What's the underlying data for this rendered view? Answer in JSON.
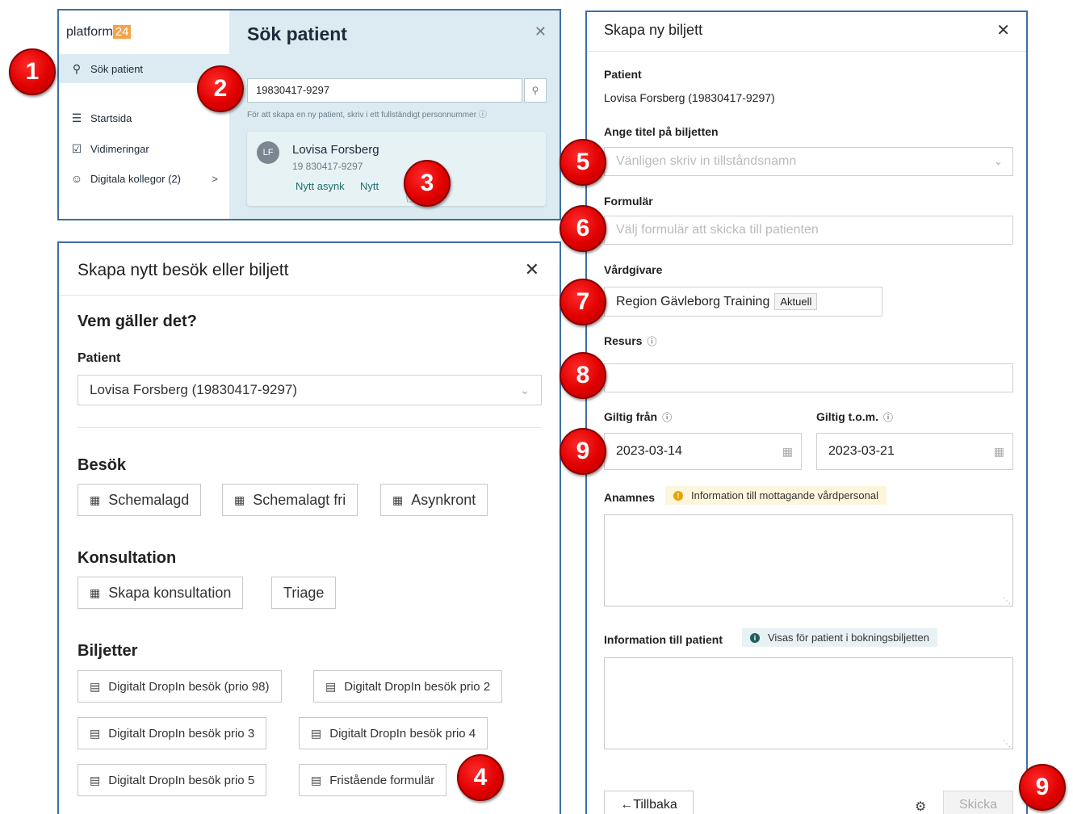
{
  "search_panel": {
    "logo_text": "platform",
    "logo_number": "24",
    "nav": [
      {
        "label": "Sök patient",
        "icon": "search-icon"
      },
      {
        "label": "Startsida",
        "icon": "list-icon"
      },
      {
        "label": "Vidimeringar",
        "icon": "checkbox-icon"
      },
      {
        "label": "Digitala kollegor (2)",
        "icon": "people-icon"
      }
    ],
    "title": "Sök patient",
    "search_value": "19830417-9297",
    "hint": "För att skapa en ny patient, skriv i ett fullständigt personnummer",
    "result": {
      "initials": "LF",
      "name": "Lovisa Forsberg",
      "id": "19 830417-9297",
      "link_async": "Nytt asynk",
      "link_new": "Nytt"
    }
  },
  "visit_panel": {
    "title": "Skapa nytt besök eller biljett",
    "question": "Vem gäller det?",
    "patient_label": "Patient",
    "patient_value": "Lovisa Forsberg (19830417-9297)",
    "besok_heading": "Besök",
    "besok_buttons": [
      "Schemalagd",
      "Schemalagt fri",
      "Asynkront"
    ],
    "konsultation_heading": "Konsultation",
    "konsultation_buttons": [
      "Skapa konsultation",
      "Triage"
    ],
    "biljetter_heading": "Biljetter",
    "biljetter_buttons": [
      "Digitalt DropIn besök (prio 98)",
      "Digitalt DropIn besök prio 2",
      "Digitalt DropIn besök prio 3",
      "Digitalt DropIn besök prio 4",
      "Digitalt DropIn besök prio 5",
      "Fristående formulär"
    ]
  },
  "ticket_panel": {
    "title": "Skapa ny biljett",
    "patient_label": "Patient",
    "patient_value": "Lovisa Forsberg (19830417-9297)",
    "title_label": "Ange titel på biljetten",
    "title_placeholder": "Vänligen skriv in tillståndsnamn",
    "form_label": "Formulär",
    "form_placeholder": "Välj formulär att skicka till patienten",
    "provider_label": "Vårdgivare",
    "provider_value": "Region Gävleborg Training",
    "provider_tag": "Aktuell",
    "resource_label": "Resurs",
    "valid_from_label": "Giltig från",
    "valid_from_value": "2023-03-14",
    "valid_to_label": "Giltig t.o.m.",
    "valid_to_value": "2023-03-21",
    "anamnes_label": "Anamnes",
    "anamnes_notice": "Information till mottagande vårdpersonal",
    "patient_info_label": "Information till patient",
    "patient_info_notice": "Visas för patient i bokningsbiljetten",
    "back_button": "←Tillbaka",
    "send_button": "Skicka"
  },
  "markers": [
    "1",
    "2",
    "3",
    "4",
    "5",
    "6",
    "7",
    "8",
    "9",
    "9"
  ],
  "colors": {
    "frame_border": "#3f6ea3",
    "sidebar_active": "#dcebf1",
    "marker_red": "#e00000",
    "warning_notice": "#fdf6dc",
    "info_notice": "#e8f1f4"
  }
}
